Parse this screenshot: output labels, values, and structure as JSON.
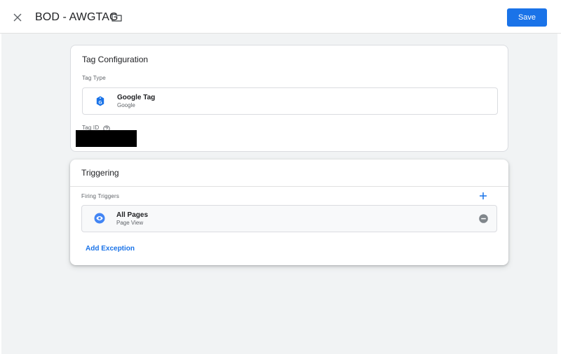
{
  "header": {
    "title": "BOD - AWGTAG",
    "save_label": "Save"
  },
  "tag_configuration": {
    "title": "Tag Configuration",
    "tag_type_label": "Tag Type",
    "tag_type": {
      "name": "Google Tag",
      "vendor": "Google",
      "icon": "google-tag-icon"
    },
    "tag_id_label": "Tag ID"
  },
  "triggering": {
    "title": "Triggering",
    "firing_triggers_label": "Firing Triggers",
    "triggers": [
      {
        "name": "All Pages",
        "type": "Page View",
        "icon": "eye-icon"
      }
    ],
    "add_exception_label": "Add Exception"
  },
  "colors": {
    "accent": "#1a73e8",
    "background": "#f1f3f4",
    "card": "#ffffff",
    "text_primary": "#202124",
    "text_secondary": "#5f6368",
    "remove_icon": "#80868b"
  }
}
